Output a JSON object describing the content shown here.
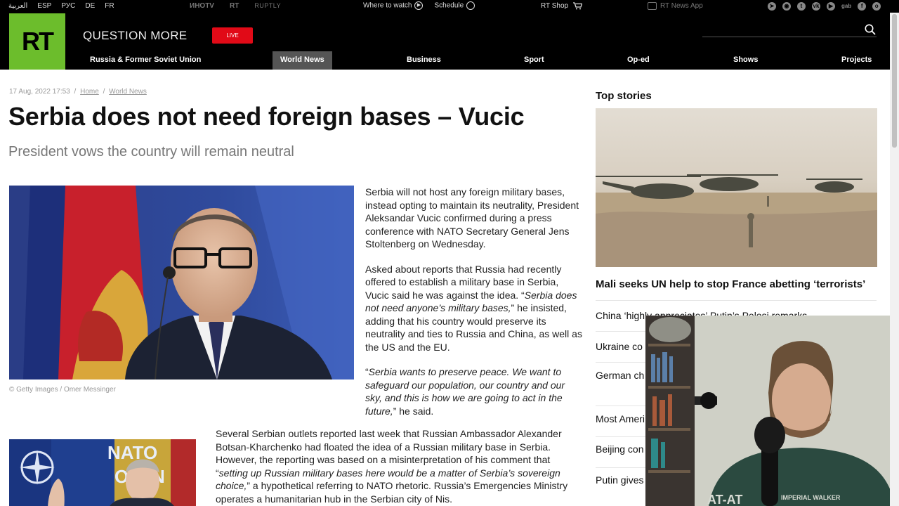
{
  "utility_bar": {
    "languages": [
      "العربية",
      "ESP",
      "РУС",
      "DE",
      "FR"
    ],
    "partners": [
      "ИНОTV",
      "RT",
      "RUPTLY"
    ],
    "where_to_watch": "Where to watch",
    "schedule": "Schedule",
    "shop": "RT Shop",
    "news_app": "RT News App",
    "socials": [
      "telegram-icon",
      "rss-icon",
      "twitter-icon",
      "vk-icon",
      "youtube-icon",
      "gab",
      "facebook-icon",
      "odnoklassniki-icon"
    ],
    "gab_label": "gab"
  },
  "header": {
    "logo": "RT",
    "tagline": "QUESTION MORE",
    "live": "LIVE",
    "nav": [
      "Russia & Former Soviet Union",
      "World News",
      "Business",
      "Sport",
      "Op-ed",
      "Shows",
      "Projects"
    ],
    "active_nav": "World News"
  },
  "article": {
    "date": "17 Aug, 2022 17:53",
    "breadcrumb": [
      "Home",
      "World News"
    ],
    "headline": "Serbia does not need foreign bases – Vucic",
    "subheadline": "President vows the country will remain neutral",
    "photo_caption": "© Getty Images / Omer Messinger",
    "para1": "Serbia will not host any foreign military bases, instead opting to maintain its neutrality, President Aleksandar Vucic confirmed during a press conference with NATO Secretary General Jens Stoltenberg on Wednesday.",
    "para2_a": "Asked about reports that Russia had recently offered to establish a military base in Serbia, Vucic said he was against the idea. “",
    "para2_quote": "Serbia does not need anyone’s military bases,",
    "para2_b": "” he insisted, adding that his country would preserve its neutrality and ties to Russia and China, as well as the US and the EU.",
    "para3_a": "“",
    "para3_quote": "Serbia wants to preserve peace. We want to safeguard our population, our country and our sky, and this is how we are going to act in the future,",
    "para3_b": "” he said.",
    "para4_a": "Several Serbian outlets reported last week that Russian Ambassador Alexander Botsan-Kharchenko had floated the idea of a Russian military base in Serbia. However, the reporting was based on a misinterpretation of his comment that “",
    "para4_quote": "setting up Russian military bases here would be a matter of Serbia’s sovereign choice,",
    "para4_b": "” a hypothetical referring to NATO rhetoric. Russia’s Emergencies Ministry operates a humanitarian hub in the Serbian city of Nis.",
    "nato_sign": "NATO OTAN"
  },
  "sidebar": {
    "title": "Top stories",
    "lead_story": "Mali seeks UN help to stop France abetting ‘terrorists’",
    "stories": [
      "China ‘highly appreciates’ Putin’s Pelosi remarks",
      "Ukraine co",
      "German ch criticism",
      "Most Ameri",
      "Beijing con",
      "Putin gives"
    ]
  },
  "webcam": {
    "shirt_text": "AT-AT",
    "shirt_subtext": "IMPERIAL WALKER"
  },
  "colors": {
    "brand_green": "#6cbd2c",
    "live_red": "#e10a17",
    "header_black": "#000000"
  }
}
